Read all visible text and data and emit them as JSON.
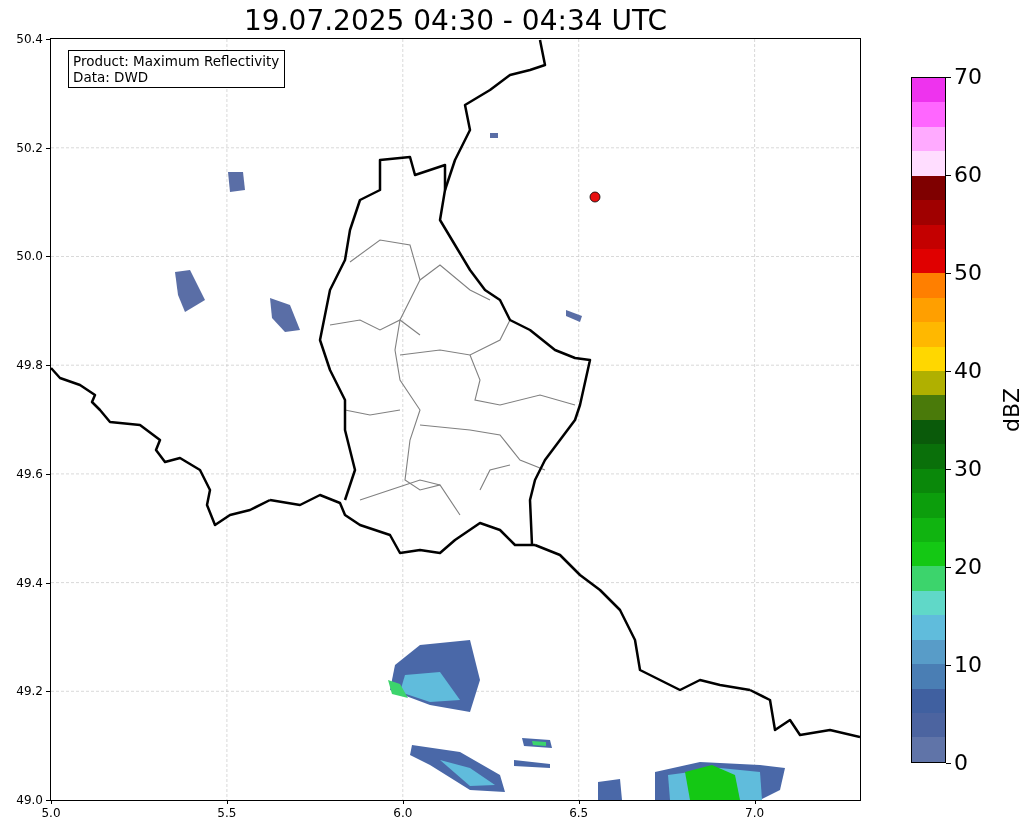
{
  "title": "19.07.2025 04:30 - 04:34 UTC",
  "info_box": [
    "Product: Maximum Reflectivity",
    "Data: DWD"
  ],
  "map": {
    "xticks": [
      "5.0",
      "5.5",
      "6.0",
      "6.5",
      "7.0"
    ],
    "yticks": [
      "50.4",
      "50.2",
      "50.0",
      "49.8",
      "49.6",
      "49.4",
      "49.2",
      "49.0"
    ]
  },
  "colorbar": {
    "label": "dBZ",
    "ticks": [
      "70",
      "60",
      "50",
      "40",
      "30",
      "20",
      "10",
      "0"
    ],
    "segments": [
      {
        "color": "#ee33ee"
      },
      {
        "color": "#ff66ff"
      },
      {
        "color": "#ffaaff"
      },
      {
        "color": "#ffddff"
      },
      {
        "color": "#7f0000"
      },
      {
        "color": "#a00000"
      },
      {
        "color": "#c40000"
      },
      {
        "color": "#e00000"
      },
      {
        "color": "#ff7f00"
      },
      {
        "color": "#ff9f00"
      },
      {
        "color": "#ffb800"
      },
      {
        "color": "#ffd700"
      },
      {
        "color": "#b0b000"
      },
      {
        "color": "#4a7a0a"
      },
      {
        "color": "#0a5a0a"
      },
      {
        "color": "#0a700a"
      },
      {
        "color": "#0a880a"
      },
      {
        "color": "#0c9e0c"
      },
      {
        "color": "#10b410"
      },
      {
        "color": "#14c814"
      },
      {
        "color": "#3cd46c"
      },
      {
        "color": "#60d8c8"
      },
      {
        "color": "#60bcdc"
      },
      {
        "color": "#589cc8"
      },
      {
        "color": "#4a7eb4"
      },
      {
        "color": "#4060a0"
      },
      {
        "color": "#4c64a0"
      },
      {
        "color": "#6074a8"
      }
    ]
  }
}
